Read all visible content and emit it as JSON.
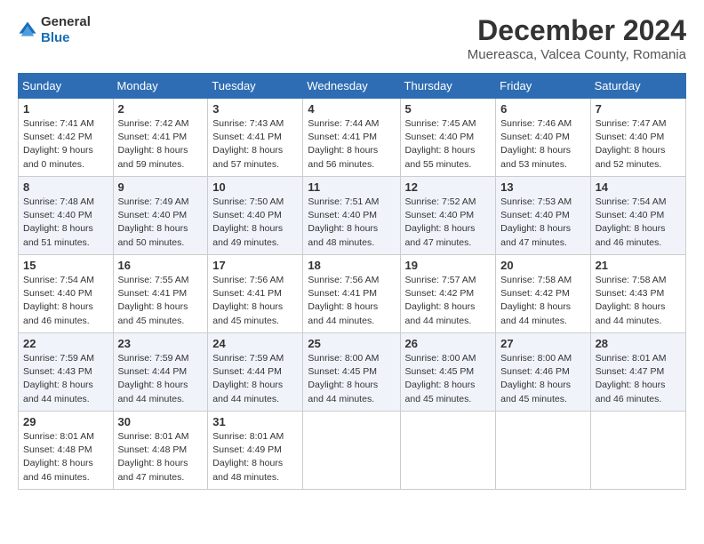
{
  "logo": {
    "general": "General",
    "blue": "Blue"
  },
  "title": "December 2024",
  "location": "Muereasca, Valcea County, Romania",
  "weekdays": [
    "Sunday",
    "Monday",
    "Tuesday",
    "Wednesday",
    "Thursday",
    "Friday",
    "Saturday"
  ],
  "weeks": [
    [
      {
        "day": "1",
        "sunrise": "7:41 AM",
        "sunset": "4:42 PM",
        "daylight": "9 hours and 0 minutes."
      },
      {
        "day": "2",
        "sunrise": "7:42 AM",
        "sunset": "4:41 PM",
        "daylight": "8 hours and 59 minutes."
      },
      {
        "day": "3",
        "sunrise": "7:43 AM",
        "sunset": "4:41 PM",
        "daylight": "8 hours and 57 minutes."
      },
      {
        "day": "4",
        "sunrise": "7:44 AM",
        "sunset": "4:41 PM",
        "daylight": "8 hours and 56 minutes."
      },
      {
        "day": "5",
        "sunrise": "7:45 AM",
        "sunset": "4:40 PM",
        "daylight": "8 hours and 55 minutes."
      },
      {
        "day": "6",
        "sunrise": "7:46 AM",
        "sunset": "4:40 PM",
        "daylight": "8 hours and 53 minutes."
      },
      {
        "day": "7",
        "sunrise": "7:47 AM",
        "sunset": "4:40 PM",
        "daylight": "8 hours and 52 minutes."
      }
    ],
    [
      {
        "day": "8",
        "sunrise": "7:48 AM",
        "sunset": "4:40 PM",
        "daylight": "8 hours and 51 minutes."
      },
      {
        "day": "9",
        "sunrise": "7:49 AM",
        "sunset": "4:40 PM",
        "daylight": "8 hours and 50 minutes."
      },
      {
        "day": "10",
        "sunrise": "7:50 AM",
        "sunset": "4:40 PM",
        "daylight": "8 hours and 49 minutes."
      },
      {
        "day": "11",
        "sunrise": "7:51 AM",
        "sunset": "4:40 PM",
        "daylight": "8 hours and 48 minutes."
      },
      {
        "day": "12",
        "sunrise": "7:52 AM",
        "sunset": "4:40 PM",
        "daylight": "8 hours and 47 minutes."
      },
      {
        "day": "13",
        "sunrise": "7:53 AM",
        "sunset": "4:40 PM",
        "daylight": "8 hours and 47 minutes."
      },
      {
        "day": "14",
        "sunrise": "7:54 AM",
        "sunset": "4:40 PM",
        "daylight": "8 hours and 46 minutes."
      }
    ],
    [
      {
        "day": "15",
        "sunrise": "7:54 AM",
        "sunset": "4:40 PM",
        "daylight": "8 hours and 46 minutes."
      },
      {
        "day": "16",
        "sunrise": "7:55 AM",
        "sunset": "4:41 PM",
        "daylight": "8 hours and 45 minutes."
      },
      {
        "day": "17",
        "sunrise": "7:56 AM",
        "sunset": "4:41 PM",
        "daylight": "8 hours and 45 minutes."
      },
      {
        "day": "18",
        "sunrise": "7:56 AM",
        "sunset": "4:41 PM",
        "daylight": "8 hours and 44 minutes."
      },
      {
        "day": "19",
        "sunrise": "7:57 AM",
        "sunset": "4:42 PM",
        "daylight": "8 hours and 44 minutes."
      },
      {
        "day": "20",
        "sunrise": "7:58 AM",
        "sunset": "4:42 PM",
        "daylight": "8 hours and 44 minutes."
      },
      {
        "day": "21",
        "sunrise": "7:58 AM",
        "sunset": "4:43 PM",
        "daylight": "8 hours and 44 minutes."
      }
    ],
    [
      {
        "day": "22",
        "sunrise": "7:59 AM",
        "sunset": "4:43 PM",
        "daylight": "8 hours and 44 minutes."
      },
      {
        "day": "23",
        "sunrise": "7:59 AM",
        "sunset": "4:44 PM",
        "daylight": "8 hours and 44 minutes."
      },
      {
        "day": "24",
        "sunrise": "7:59 AM",
        "sunset": "4:44 PM",
        "daylight": "8 hours and 44 minutes."
      },
      {
        "day": "25",
        "sunrise": "8:00 AM",
        "sunset": "4:45 PM",
        "daylight": "8 hours and 44 minutes."
      },
      {
        "day": "26",
        "sunrise": "8:00 AM",
        "sunset": "4:45 PM",
        "daylight": "8 hours and 45 minutes."
      },
      {
        "day": "27",
        "sunrise": "8:00 AM",
        "sunset": "4:46 PM",
        "daylight": "8 hours and 45 minutes."
      },
      {
        "day": "28",
        "sunrise": "8:01 AM",
        "sunset": "4:47 PM",
        "daylight": "8 hours and 46 minutes."
      }
    ],
    [
      {
        "day": "29",
        "sunrise": "8:01 AM",
        "sunset": "4:48 PM",
        "daylight": "8 hours and 46 minutes."
      },
      {
        "day": "30",
        "sunrise": "8:01 AM",
        "sunset": "4:48 PM",
        "daylight": "8 hours and 47 minutes."
      },
      {
        "day": "31",
        "sunrise": "8:01 AM",
        "sunset": "4:49 PM",
        "daylight": "8 hours and 48 minutes."
      },
      null,
      null,
      null,
      null
    ]
  ]
}
